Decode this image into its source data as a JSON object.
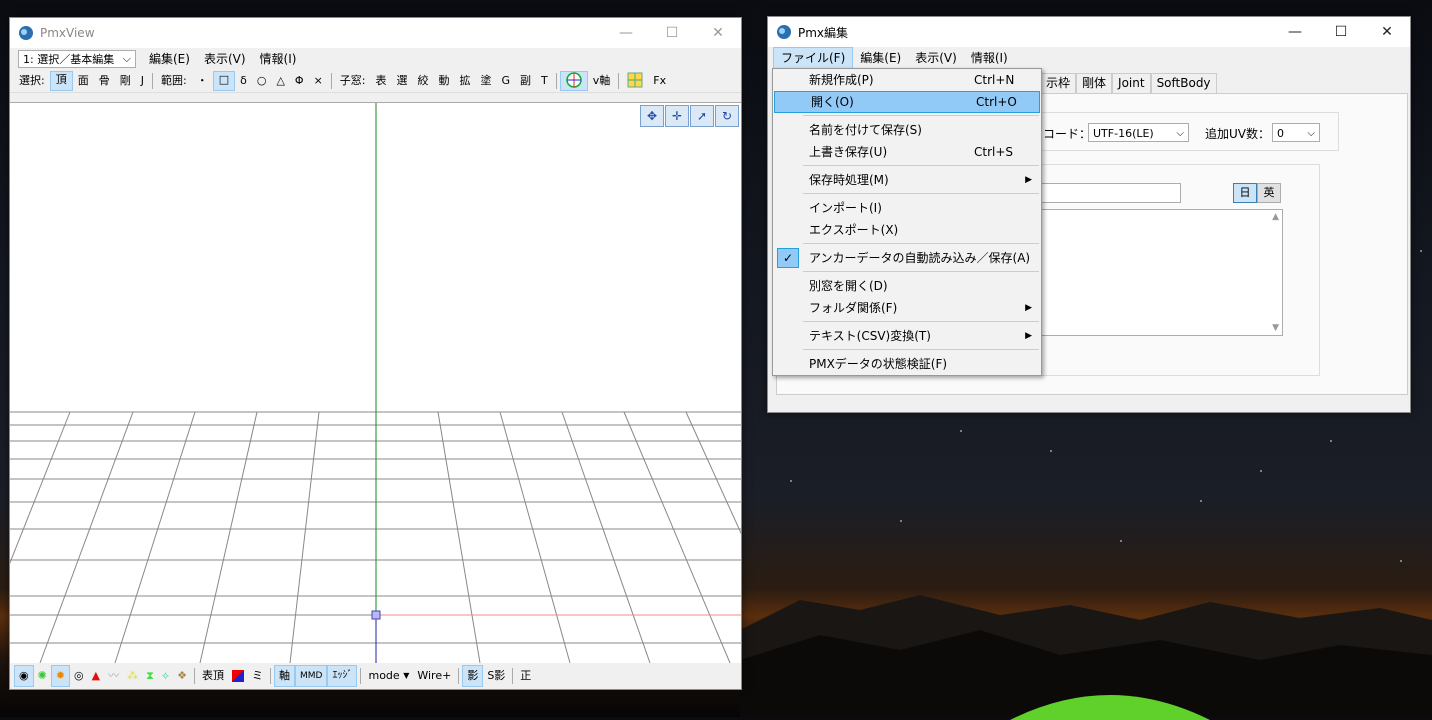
{
  "pmxview": {
    "title": "PmxView",
    "mode_select": "1: 選択／基本編集",
    "menu": [
      "編集(E)",
      "表示(V)",
      "情報(I)"
    ],
    "toolbar": {
      "select_label": "選択:",
      "select_items": [
        "頂",
        "面",
        "骨",
        "剛",
        "J"
      ],
      "range_label": "範囲:",
      "range_items": [
        "・",
        "□",
        "δ",
        "○",
        "△",
        "Φ",
        "×"
      ],
      "child_label": "子窓:",
      "child_items": [
        "表",
        "選",
        "絞",
        "動",
        "拡",
        "塗",
        "G",
        "副",
        "T"
      ],
      "axis_label": "v軸",
      "fx_label": "Fx"
    },
    "bottombar": {
      "label_vertex": "表頂",
      "label_mi": "ミ",
      "label_axis": "軸",
      "label_mmd": "MMD",
      "label_edge": "ｴｯｼﾞ",
      "label_mode": "mode",
      "label_wire": "Wire+",
      "label_shadow": "影",
      "label_sshadow": "S影",
      "label_ortho": "正"
    }
  },
  "pmxedit": {
    "title": "Pmx編集",
    "menu": [
      "ファイル(F)",
      "編集(E)",
      "表示(V)",
      "情報(I)"
    ],
    "tabs": [
      "示枠",
      "剛体",
      "Joint",
      "SoftBody"
    ],
    "encoding_label": "ソコード：",
    "encoding_value": "UTF-16(LE)",
    "uv_label": "追加UV数：",
    "uv_value": "0",
    "lang_jp": "日",
    "lang_en": "英"
  },
  "file_menu": {
    "items": [
      {
        "label": "新規作成(P)",
        "shortcut": "Ctrl+N"
      },
      {
        "label": "開く(O)",
        "shortcut": "Ctrl+O"
      },
      {
        "label": "名前を付けて保存(S)",
        "shortcut": ""
      },
      {
        "label": "上書き保存(U)",
        "shortcut": "Ctrl+S"
      },
      {
        "label": "保存時処理(M)",
        "shortcut": ""
      },
      {
        "label": "インポート(I)",
        "shortcut": ""
      },
      {
        "label": "エクスポート(X)",
        "shortcut": ""
      },
      {
        "label": "アンカーデータの自動読み込み／保存(A)",
        "shortcut": ""
      },
      {
        "label": "別窓を開く(D)",
        "shortcut": ""
      },
      {
        "label": "フォルダ関係(F)",
        "shortcut": ""
      },
      {
        "label": "テキスト(CSV)変換(T)",
        "shortcut": ""
      },
      {
        "label": "PMXデータの状態検証(F)",
        "shortcut": ""
      }
    ]
  }
}
